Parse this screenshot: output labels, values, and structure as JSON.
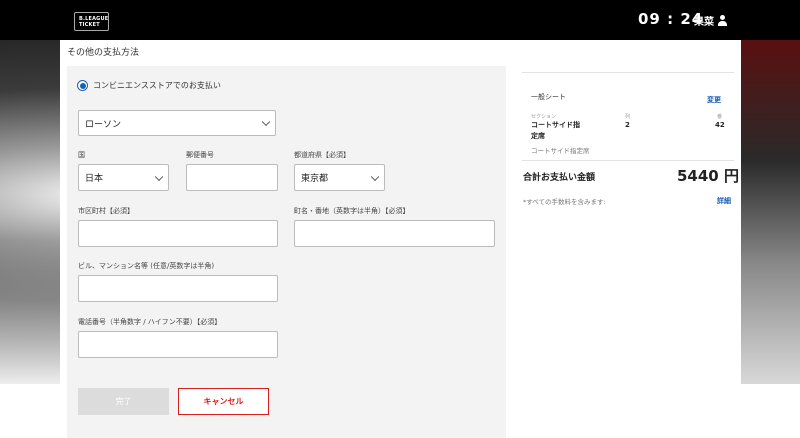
{
  "header": {
    "logo_line1": "B.LEAGUE",
    "logo_line2": "TICKET",
    "clock": "09 : 24",
    "user_name": "果菜"
  },
  "page": {
    "title": "その他の支払方法"
  },
  "payment": {
    "option_label": "コンビニエンスストアでのお支払い",
    "store_select": "ローソン"
  },
  "form": {
    "country_label": "国",
    "country_value": "日本",
    "postal_label": "郵便番号",
    "postal_value": "",
    "prefecture_label": "都道府県【必須】",
    "prefecture_value": "東京都",
    "city_label": "市区町村【必須】",
    "city_value": "",
    "street_label": "町名・番地（英数字は半角）【必須】",
    "street_value": "",
    "building_label": "ビル、マンション名等 (任意/英数字は半角)",
    "building_value": "",
    "phone_label": "電話番号（半角数字 / ハイフン不要）【必須】",
    "phone_value": "",
    "done_button": "完了",
    "cancel_button": "キャンセル"
  },
  "summary": {
    "seat_type": "一般シート",
    "change_link": "変更",
    "section_header": "セクション",
    "row_header": "列",
    "seat_header": "番",
    "section_value_line1": "コートサイド指",
    "section_value_line2": "定席",
    "row_value": "2",
    "seat_value": "42",
    "seat_subtitle": "コートサイド指定席",
    "total_label": "合計お支払い金額",
    "total_value": "5440 円",
    "fee_note": "*すべての手数料を含みます:",
    "detail_link": "詳細"
  },
  "colors": {
    "accent_blue": "#1a5fb4",
    "cancel_red": "#d61f1f",
    "topbar": "#000000",
    "form_bg": "#f3f3f3"
  }
}
